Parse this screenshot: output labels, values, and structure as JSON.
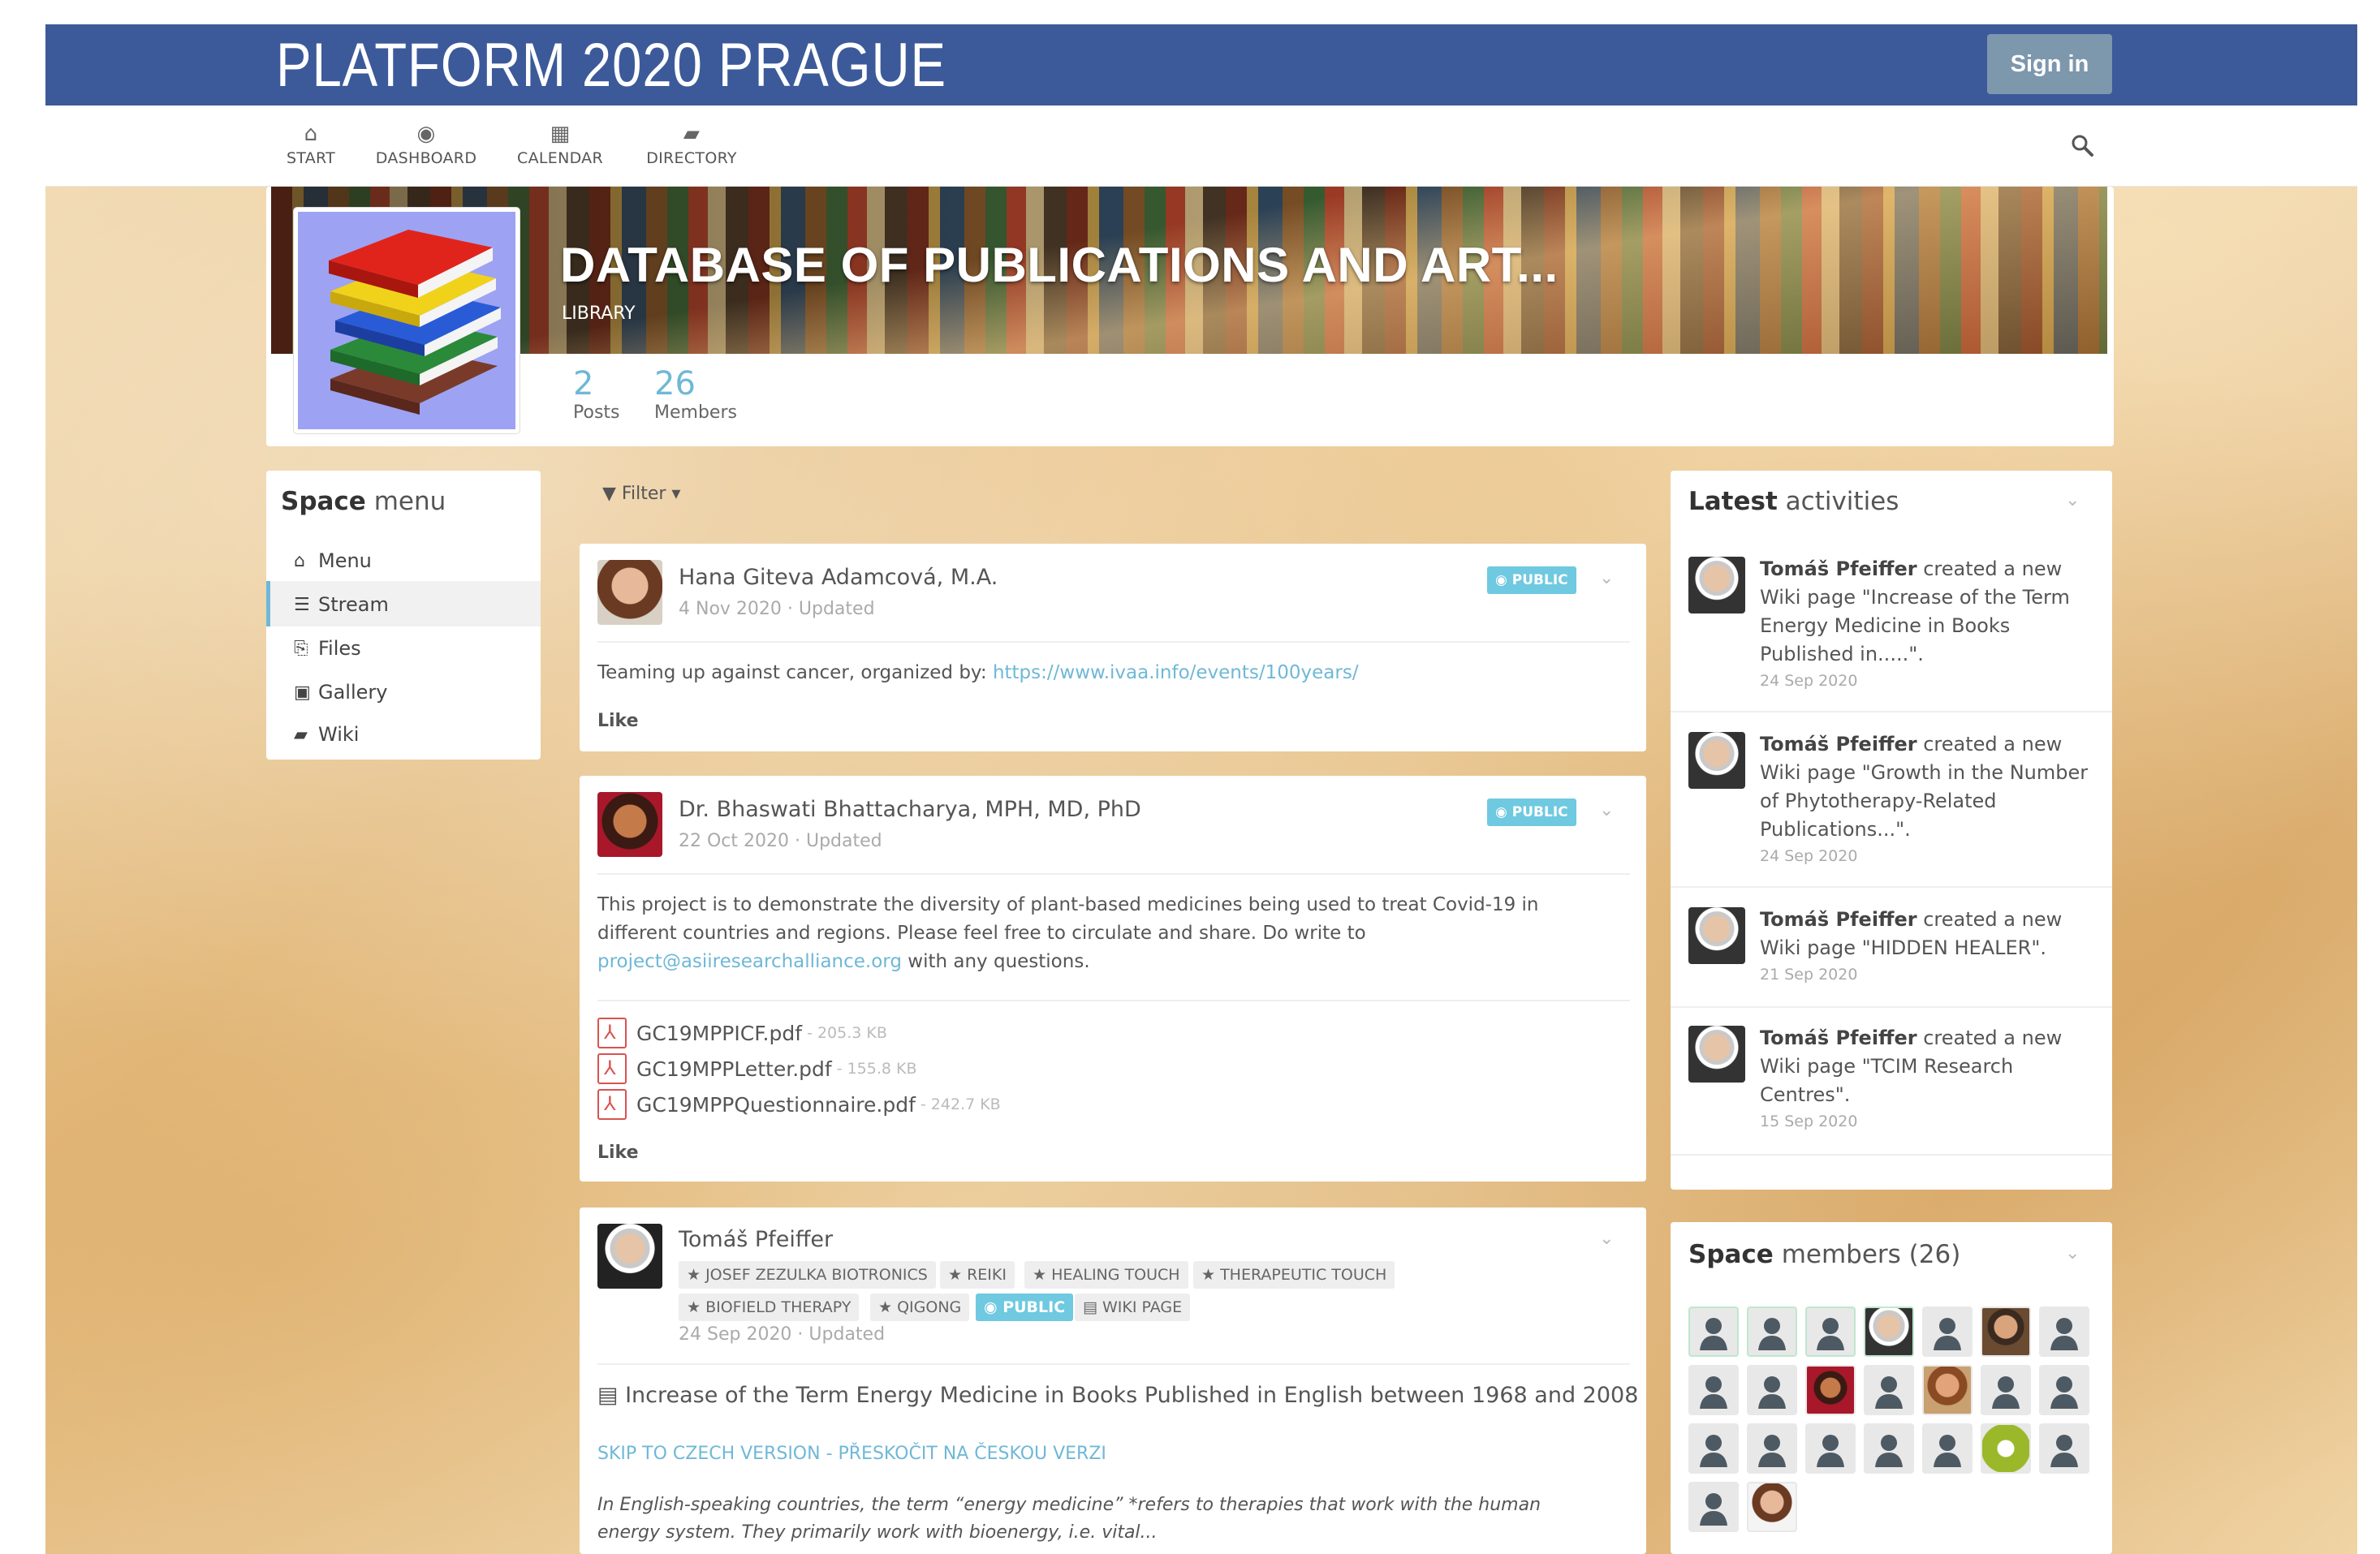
{
  "app": {
    "brand": "PLATFORM 2020 PRAGUE",
    "sign_in": "Sign in",
    "accent": "#3c5a99"
  },
  "nav": [
    {
      "label": "START",
      "icon": "home-icon"
    },
    {
      "label": "DASHBOARD",
      "icon": "tachometer-icon"
    },
    {
      "label": "CALENDAR",
      "icon": "calendar-icon"
    },
    {
      "label": "DIRECTORY",
      "icon": "book-icon"
    }
  ],
  "space": {
    "title": "DATABASE OF PUBLICATIONS AND ART...",
    "subtitle": "LIBRARY",
    "posts_count": "2",
    "posts_label": "Posts",
    "members_count": "26",
    "members_label": "Members"
  },
  "space_menu": {
    "title_bold": "Space",
    "title_rest": " menu",
    "items": [
      {
        "label": "Menu",
        "icon": "home-icon"
      },
      {
        "label": "Stream",
        "icon": "bars-icon",
        "active": true
      },
      {
        "label": "Files",
        "icon": "files-icon"
      },
      {
        "label": "Gallery",
        "icon": "image-icon"
      },
      {
        "label": "Wiki",
        "icon": "book-icon"
      }
    ]
  },
  "filter_label": "Filter",
  "posts": [
    {
      "author": "Hana Giteva Adamcová, M.A.",
      "date": "4 Nov 2020 · Updated",
      "visibility": "PUBLIC",
      "text": "Teaming up against cancer, organized by: ",
      "link": "https://www.ivaa.info/events/100years/",
      "like": "Like"
    },
    {
      "author": "Dr. Bhaswati Bhattacharya, MPH, MD, PhD",
      "date": "22 Oct 2020 · Updated",
      "visibility": "PUBLIC",
      "text_line1": "This project is to demonstrate the diversity of plant-based medicines being used to treat Covid-19 in",
      "text_line2": "different countries and regions. Please feel free to circulate and share. Do write to",
      "email": "project@asiiresearchalliance.org",
      "text_line3_rest": " with any questions.",
      "files": [
        {
          "name": "GC19MPPICF.pdf",
          "size": "- 205.3 KB"
        },
        {
          "name": "GC19MPPLetter.pdf",
          "size": "- 155.8 KB"
        },
        {
          "name": "GC19MPPQuestionnaire.pdf",
          "size": "- 242.7 KB"
        }
      ],
      "like": "Like"
    },
    {
      "author": "Tomáš Pfeiffer",
      "tags_row1": [
        "JOSEF ZEZULKA BIOTRONICS",
        "REIKI",
        "HEALING TOUCH",
        "THERAPEUTIC TOUCH"
      ],
      "tags_row2": [
        "BIOFIELD THERAPY",
        "QIGONG"
      ],
      "visibility": "PUBLIC",
      "wiki_tag": "WIKI PAGE",
      "date": "24 Sep 2020 · Updated",
      "wiki_title": "Increase of the Term Energy Medicine in Books Published in English between 1968 and 2008",
      "skip_link": "SKIP TO CZECH VERSION - PŘESKOČIT NA ČESKOU VERZI",
      "excerpt_line1": "In English-speaking countries, the term “energy medicine” *refers to therapies that work with the human",
      "excerpt_line2": "energy system. They primarily work with bioenergy, i.e. vital..."
    }
  ],
  "latest_activities": {
    "title_bold": "Latest",
    "title_rest": " activities",
    "items": [
      {
        "user": "Tomáš Pfeiffer",
        "line1": " created a new",
        "line2": "Wiki page \"Increase of the Term",
        "line3": "Energy Medicine in Books",
        "line4": "Published in.....\".",
        "date": "24 Sep 2020"
      },
      {
        "user": "Tomáš Pfeiffer",
        "line1": " created a new",
        "line2": "Wiki page \"Growth in the Number",
        "line3": "of Phytotherapy-Related",
        "line4": "Publications...\".",
        "date": "24 Sep 2020"
      },
      {
        "user": "Tomáš Pfeiffer",
        "line1": " created a new",
        "line2": "Wiki page \"HIDDEN HEALER\".",
        "date": "21 Sep 2020"
      },
      {
        "user": "Tomáš Pfeiffer",
        "line1": " created a new",
        "line2": "Wiki page \"TCIM Research",
        "line3": "Centres\".",
        "date": "15 Sep 2020"
      }
    ]
  },
  "space_members": {
    "title_bold": "Space",
    "title_rest": " members (26)"
  }
}
